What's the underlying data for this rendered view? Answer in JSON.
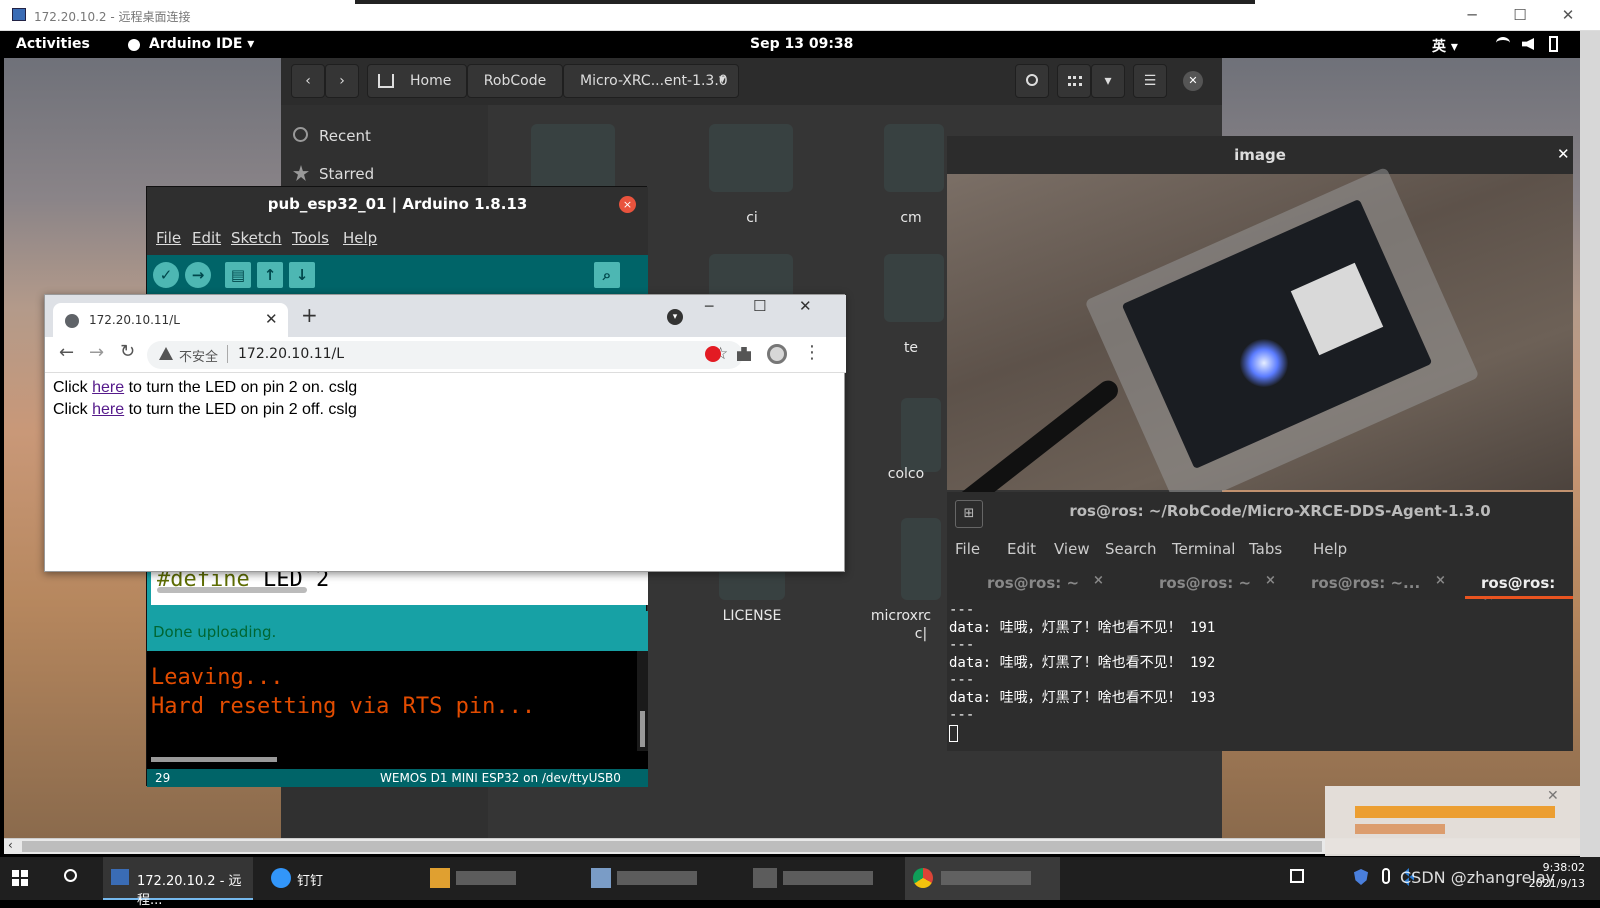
{
  "rdp": {
    "title": "172.20.10.2 - 远程桌面连接",
    "min": "─",
    "max": "☐",
    "close": "✕"
  },
  "topbar": {
    "activities": "Activities",
    "app": "Arduino IDE ▾",
    "clock": "Sep 13  09:38",
    "input_method": "英 ▾",
    "icons": [
      "wifi-icon",
      "volume-icon",
      "battery-icon"
    ]
  },
  "files": {
    "nav_back": "‹",
    "nav_forward": "›",
    "path": [
      "Home",
      "RobCode",
      "Micro-XRC...ent-1.3.0"
    ],
    "path_dropdown": "▾",
    "search_icon": "search-icon",
    "view_icon": "list-view-icon",
    "view_dropdown": "▾",
    "menu_icon": "☰",
    "close": "✕",
    "sidebar": [
      {
        "label": "Recent",
        "icon": "clock-icon"
      },
      {
        "label": "Starred",
        "icon": "star-icon"
      }
    ],
    "items": [
      "ci",
      "cm",
      "te",
      "colco",
      "LICENSE",
      "microxrc",
      "c|"
    ]
  },
  "arduino": {
    "title": "pub_esp32_01 | Arduino 1.8.13",
    "close": "×",
    "menu": [
      "File",
      "Edit",
      "Sketch",
      "Tools",
      "Help"
    ],
    "toolbar": {
      "verify": "✓",
      "upload": "→",
      "new": "▤",
      "open": "↑",
      "save": "↓",
      "serial": "⌕"
    },
    "code_define": "#define",
    "code_rest": " LED 2",
    "status": "Done uploading.",
    "console": [
      "Leaving...",
      "Hard resetting via RTS pin..."
    ],
    "line_number": "29",
    "board": "WEMOS D1 MINI ESP32 on /dev/ttyUSB0"
  },
  "chrome": {
    "tab_title": "172.20.10.11/L",
    "tab_close": "✕",
    "new_tab": "+",
    "win_min": "─",
    "win_max": "☐",
    "win_close": "✕",
    "back": "←",
    "forward": "→",
    "reload": "↻",
    "insecure_label": "不安全",
    "url": "172.20.10.11/L",
    "star": "☆",
    "more": "⋮",
    "line1_pre": "Click ",
    "line1_link": "here",
    "line1_post": " to turn the LED on pin 2 on. cslg",
    "line2_pre": "Click ",
    "line2_link": "here",
    "line2_post": " to turn the LED on pin 2 off. cslg"
  },
  "image_viewer": {
    "title": "image",
    "close": "✕"
  },
  "terminal": {
    "title": "ros@ros: ~/RobCode/Micro-XRCE-DDS-Agent-1.3.0",
    "menu": [
      "File",
      "Edit",
      "View",
      "Search",
      "Terminal",
      "Tabs",
      "Help"
    ],
    "tabs": [
      "ros@ros: ~",
      "ros@ros: ~",
      "ros@ros: ~...",
      "ros@ros: ~..."
    ],
    "tab_close": "×",
    "lines": [
      "---",
      "data: 哇哦，灯黑了！啥也看不见！ 191",
      "---",
      "data: 哇哦，灯黑了！啥也看不见！ 192",
      "---",
      "data: 哇哦，灯黑了！啥也看不见！ 193",
      "---"
    ]
  },
  "taskbar": {
    "search_icon": "search-icon",
    "rdp_label": "172.20.10.2 - 远程...",
    "dingtalk_label": "钉钉",
    "watermark": "CSDN @zhangrelay",
    "time": "9:38:02",
    "date": "2021/9/13",
    "tray_icons": [
      "ime-icon",
      "shield-icon",
      "microphone-icon",
      "bluetooth-icon"
    ]
  }
}
